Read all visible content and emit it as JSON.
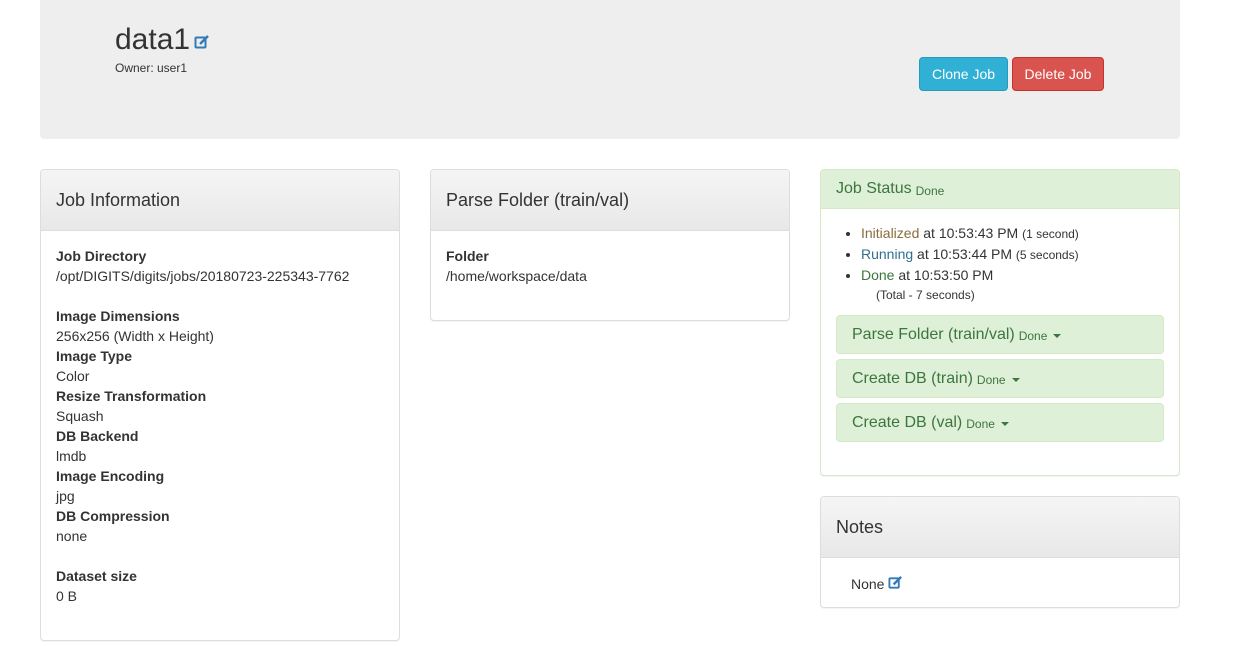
{
  "header": {
    "job_name": "data1",
    "owner": "Owner: user1",
    "clone_label": "Clone Job",
    "delete_label": "Delete Job"
  },
  "job_info": {
    "title": "Job Information",
    "job_directory_label": "Job Directory",
    "job_directory": "/opt/DIGITS/digits/jobs/20180723-225343-7762",
    "image_dimensions_label": "Image Dimensions",
    "image_dimensions": "256x256 (Width x Height)",
    "image_type_label": "Image Type",
    "image_type": "Color",
    "resize_label": "Resize Transformation",
    "resize": "Squash",
    "db_backend_label": "DB Backend",
    "db_backend": "lmdb",
    "image_encoding_label": "Image Encoding",
    "image_encoding": "jpg",
    "db_compression_label": "DB Compression",
    "db_compression": "none",
    "dataset_size_label": "Dataset size",
    "dataset_size": "0 B"
  },
  "parse_folder": {
    "title": "Parse Folder (train/val)",
    "folder_label": "Folder",
    "folder": "/home/workspace/data"
  },
  "job_status": {
    "title": "Job Status",
    "status": "Done",
    "events": [
      {
        "state": "Initialized",
        "at": " at 10:53:43 PM ",
        "duration": "(1 second)"
      },
      {
        "state": "Running",
        "at": " at 10:53:44 PM ",
        "duration": "(5 seconds)"
      },
      {
        "state": "Done",
        "at": " at 10:53:50 PM",
        "duration": ""
      }
    ],
    "total": "(Total - 7 seconds)",
    "stages": [
      {
        "name": "Parse Folder (train/val)",
        "status": "Done"
      },
      {
        "name": "Create DB (train)",
        "status": "Done"
      },
      {
        "name": "Create DB (val)",
        "status": "Done"
      }
    ]
  },
  "notes": {
    "title": "Notes",
    "value": "None"
  },
  "colors": {
    "clone_button": "#31b0d5",
    "delete_button": "#d9534f",
    "success_bg": "#dff0d8",
    "success_text": "#3c763d",
    "edit_icon": "#337ab7"
  },
  "icons": [
    "edit-icon",
    "caret-down-icon"
  ]
}
